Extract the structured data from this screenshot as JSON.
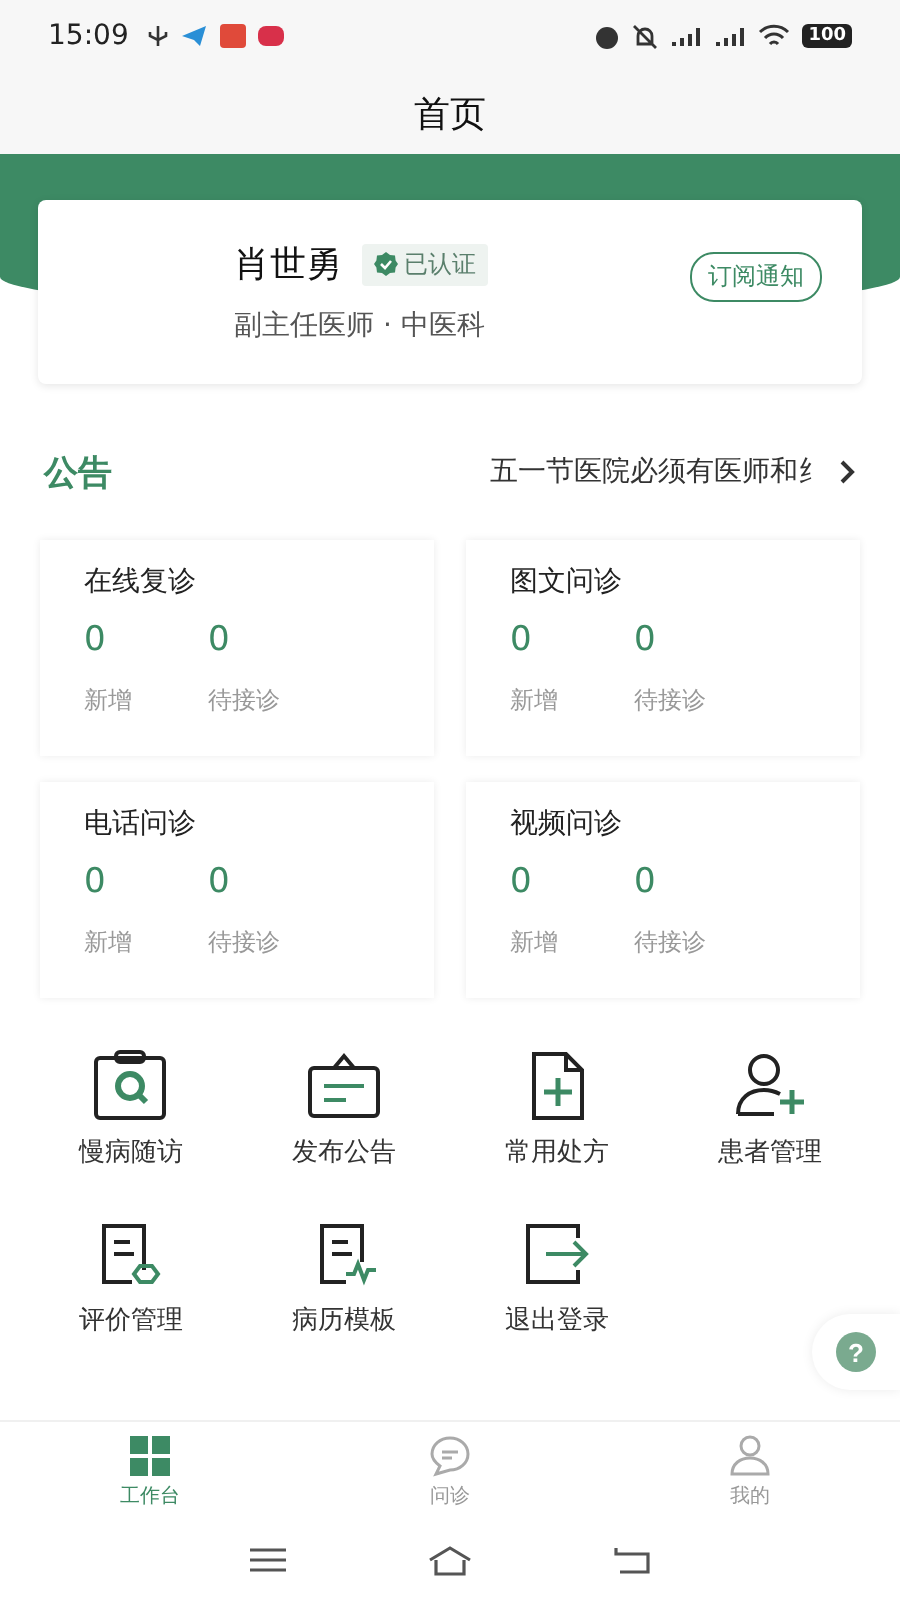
{
  "status_bar": {
    "time": "15:09",
    "battery": "100"
  },
  "header": {
    "title": "首页"
  },
  "profile": {
    "name": "肖世勇",
    "badge": "已认证",
    "subtitle": "副主任医师 · 中医科",
    "subscribe_button": "订阅通知"
  },
  "notice": {
    "label": "公告",
    "text": "五一节医院必须有医师和纟"
  },
  "stats": [
    {
      "title": "在线复诊",
      "items": [
        {
          "value": "0",
          "label": "新增"
        },
        {
          "value": "0",
          "label": "待接诊"
        }
      ]
    },
    {
      "title": "图文问诊",
      "items": [
        {
          "value": "0",
          "label": "新增"
        },
        {
          "value": "0",
          "label": "待接诊"
        }
      ]
    },
    {
      "title": "电话问诊",
      "items": [
        {
          "value": "0",
          "label": "新增"
        },
        {
          "value": "0",
          "label": "待接诊"
        }
      ]
    },
    {
      "title": "视频问诊",
      "items": [
        {
          "value": "0",
          "label": "新增"
        },
        {
          "value": "0",
          "label": "待接诊"
        }
      ]
    }
  ],
  "tools": [
    {
      "kind": "followup",
      "label": "慢病随访"
    },
    {
      "kind": "announce",
      "label": "发布公告"
    },
    {
      "kind": "prescription",
      "label": "常用处方"
    },
    {
      "kind": "patients",
      "label": "患者管理"
    },
    {
      "kind": "review",
      "label": "评价管理"
    },
    {
      "kind": "record",
      "label": "病历模板"
    },
    {
      "kind": "logout",
      "label": "退出登录"
    }
  ],
  "help_button": {
    "label": "?"
  },
  "tabs": [
    {
      "kind": "workbench",
      "label": "工作台",
      "selected": true
    },
    {
      "kind": "consult",
      "label": "问诊",
      "selected": false
    },
    {
      "kind": "mine",
      "label": "我的",
      "selected": false
    }
  ]
}
